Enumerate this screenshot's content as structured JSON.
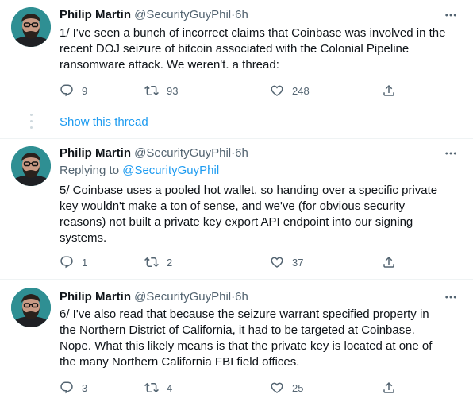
{
  "colors": {
    "link": "#1d9bf0",
    "muted": "#536471",
    "text": "#0f1419"
  },
  "tweets": [
    {
      "author_name": "Philip Martin",
      "handle": "@SecurityGuyPhil",
      "separator": "·",
      "time": "6h",
      "text_lines": [
        "1/ I've seen a bunch of incorrect claims that Coinbase was involved in the",
        "recent DOJ seizure of bitcoin associated with the Colonial Pipeline",
        "ransomware attack. We weren't. a thread:"
      ],
      "replies": "9",
      "retweets": "93",
      "likes": "248"
    },
    {
      "author_name": "Philip Martin",
      "handle": "@SecurityGuyPhil",
      "separator": "·",
      "time": "6h",
      "replying_to_label": "Replying to",
      "replying_to_handle": "@SecurityGuyPhil",
      "text_lines": [
        "5/ Coinbase uses a pooled hot wallet, so handing over a specific private",
        "key wouldn't make a ton of sense, and we've (for obvious security",
        "reasons) not built a private key export API endpoint into our signing",
        "systems."
      ],
      "replies": "1",
      "retweets": "2",
      "likes": "37"
    },
    {
      "author_name": "Philip Martin",
      "handle": "@SecurityGuyPhil",
      "separator": "·",
      "time": "6h",
      "text_lines": [
        "6/ I've also read that because the seizure warrant specified property in",
        "the Northern District of California, it had to be targeted at Coinbase.",
        "Nope.  What this likely means is that the private key is located at one of",
        "the many Northern California FBI field offices."
      ],
      "replies": "3",
      "retweets": "4",
      "likes": "25"
    }
  ],
  "show_thread_label": "Show this thread",
  "icons": {
    "more": "more-horizontal-icon",
    "reply": "reply-bubble-icon",
    "retweet": "retweet-icon",
    "like": "heart-icon",
    "share": "share-upload-icon"
  }
}
